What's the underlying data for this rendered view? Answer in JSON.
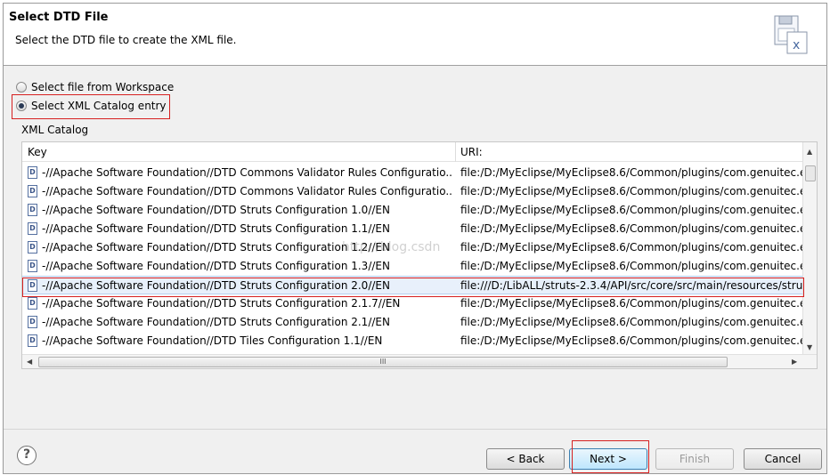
{
  "dialog": {
    "title": "Select DTD File",
    "description": "Select the DTD file to create the XML file."
  },
  "options": {
    "workspace_label": "Select file from Workspace",
    "catalog_label": "Select XML Catalog entry",
    "selected": "catalog"
  },
  "catalog": {
    "label": "XML Catalog",
    "columns": {
      "key": "Key",
      "uri": "URI:"
    },
    "rows": [
      {
        "key": "-//Apache Software Foundation//DTD Commons Validator Rules Configuratio...",
        "uri": "file:/D:/MyEclipse/MyEclipse8.6/Common/plugins/com.genuitec.ec"
      },
      {
        "key": "-//Apache Software Foundation//DTD Commons Validator Rules Configuratio...",
        "uri": "file:/D:/MyEclipse/MyEclipse8.6/Common/plugins/com.genuitec.ec"
      },
      {
        "key": "-//Apache Software Foundation//DTD Struts Configuration 1.0//EN",
        "uri": "file:/D:/MyEclipse/MyEclipse8.6/Common/plugins/com.genuitec.ec"
      },
      {
        "key": "-//Apache Software Foundation//DTD Struts Configuration 1.1//EN",
        "uri": "file:/D:/MyEclipse/MyEclipse8.6/Common/plugins/com.genuitec.ec"
      },
      {
        "key": "-//Apache Software Foundation//DTD Struts Configuration 1.2//EN",
        "uri": "file:/D:/MyEclipse/MyEclipse8.6/Common/plugins/com.genuitec.ec"
      },
      {
        "key": "-//Apache Software Foundation//DTD Struts Configuration 1.3//EN",
        "uri": "file:/D:/MyEclipse/MyEclipse8.6/Common/plugins/com.genuitec.ec"
      },
      {
        "key": "-//Apache Software Foundation//DTD Struts Configuration 2.0//EN",
        "uri": "file:///D:/LibALL/struts-2.3.4/API/src/core/src/main/resources/strut",
        "selected": true
      },
      {
        "key": "-//Apache Software Foundation//DTD Struts Configuration 2.1.7//EN",
        "uri": "file:/D:/MyEclipse/MyEclipse8.6/Common/plugins/com.genuitec.ec"
      },
      {
        "key": "-//Apache Software Foundation//DTD Struts Configuration 2.1//EN",
        "uri": "file:/D:/MyEclipse/MyEclipse8.6/Common/plugins/com.genuitec.ec"
      },
      {
        "key": "-//Apache Software Foundation//DTD Tiles Configuration 1.1//EN",
        "uri": "file:/D:/MyEclipse/MyEclipse8.6/Common/plugins/com.genuitec.ec"
      }
    ]
  },
  "watermark": "http://blog.csdn",
  "buttons": {
    "help": "?",
    "back": "< Back",
    "next": "Next >",
    "finish": "Finish",
    "cancel": "Cancel"
  },
  "icons": {
    "header": "dtd-file-wizard-icon",
    "row": "dtd-document-icon"
  },
  "colors": {
    "highlight_box": "#d62020",
    "selected_row": "#e8f0fb"
  }
}
